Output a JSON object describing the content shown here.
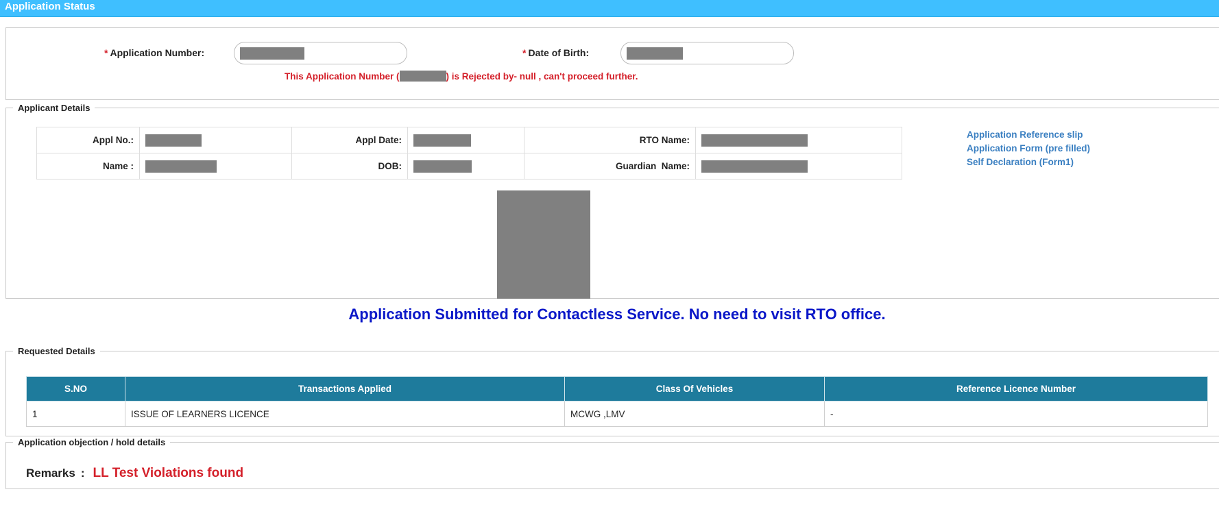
{
  "header": {
    "title": "Application Status"
  },
  "search": {
    "required_marker": "*",
    "app_number_label": "Application Number:",
    "dob_label": "Date of Birth:",
    "error": {
      "prefix": "This Application Number (",
      "suffix": ") is Rejected by- null , can't proceed further."
    }
  },
  "applicant": {
    "legend": "Applicant Details",
    "labels": {
      "appl_no": "Appl No.:",
      "appl_date": "Appl Date:",
      "rto_name": "RTO Name:",
      "name": "Name :",
      "dob": "DOB:",
      "guardian_name": "Guardian  Name:"
    },
    "links": [
      "Application Reference slip",
      "Application Form (pre filled)",
      "Self Declaration (Form1)"
    ]
  },
  "notice": "Application Submitted for Contactless Service. No need to visit RTO office.",
  "requested": {
    "legend": "Requested Details",
    "columns": [
      "S.NO",
      "Transactions Applied",
      "Class Of Vehicles",
      "Reference Licence Number"
    ],
    "rows": [
      [
        "1",
        "ISSUE OF LEARNERS LICENCE",
        "MCWG ,LMV",
        "-"
      ]
    ]
  },
  "objection": {
    "legend": "Application objection / hold details",
    "remarks_label": "Remarks",
    "separator": ":",
    "remarks_value": "LL Test Violations found"
  },
  "colors": {
    "header_bg": "#3fbfff",
    "table_header_bg": "#1e7b9c",
    "error_red": "#d4202a",
    "notice_blue": "#0a17c8",
    "link_blue": "#3a7fc1"
  }
}
